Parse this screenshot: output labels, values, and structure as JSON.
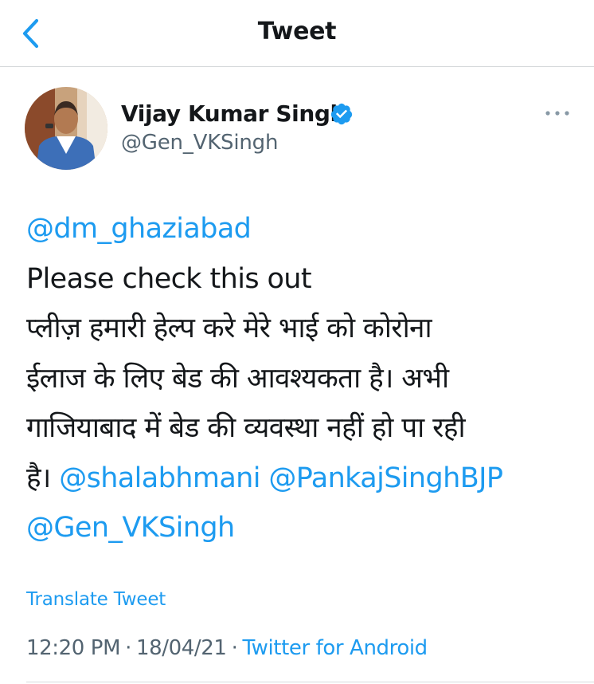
{
  "header": {
    "title": "Tweet"
  },
  "author": {
    "name": "Vijay Kumar Singh",
    "handle": "@Gen_VKSingh",
    "verified": true
  },
  "tweet": {
    "lines": [
      [
        {
          "text": "@dm_ghaziabad",
          "type": "mention"
        }
      ],
      [
        {
          "text": "Please check this out",
          "type": "text"
        }
      ],
      [
        {
          "text": "प्लीज़ हमारी हेल्प करे मेरे भाई को कोरोना",
          "type": "text"
        }
      ],
      [
        {
          "text": "ईलाज के लिए बेड की आवश्यकता है। अभी",
          "type": "text"
        }
      ],
      [
        {
          "text": "गाजियाबाद में बेड की व्यवस्था नहीं हो पा रही",
          "type": "text"
        }
      ],
      [
        {
          "text": "है। ",
          "type": "text"
        },
        {
          "text": "@shalabhmani",
          "type": "mention"
        },
        {
          "text": " ",
          "type": "text"
        },
        {
          "text": "@PankajSinghBJP",
          "type": "mention"
        }
      ],
      [
        {
          "text": "@Gen_VKSingh",
          "type": "mention"
        }
      ]
    ]
  },
  "translate_label": "Translate Tweet",
  "meta": {
    "time": "12:20 PM",
    "date": "18/04/21",
    "separator": "·",
    "source": "Twitter for Android"
  },
  "colors": {
    "accent": "#1d9bf0",
    "text_primary": "#14171a",
    "text_secondary": "#536471",
    "divider": "#d6d9db"
  },
  "icons": {
    "back": "chevron-left-icon",
    "verified": "verified-badge-icon",
    "more": "more-horizontal-icon"
  }
}
